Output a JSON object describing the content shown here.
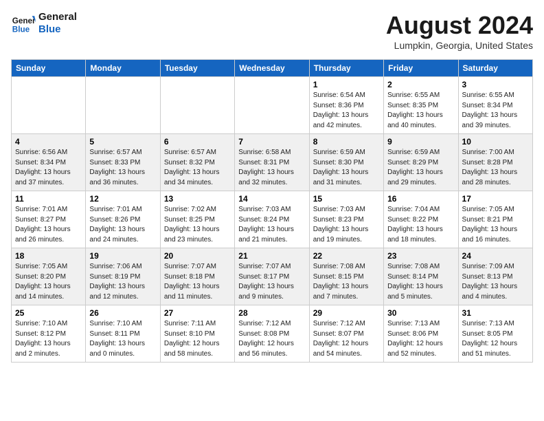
{
  "header": {
    "logo_general": "General",
    "logo_blue": "Blue",
    "month_title": "August 2024",
    "location": "Lumpkin, Georgia, United States"
  },
  "weekdays": [
    "Sunday",
    "Monday",
    "Tuesday",
    "Wednesday",
    "Thursday",
    "Friday",
    "Saturday"
  ],
  "weeks": [
    [
      {
        "day": "",
        "info": ""
      },
      {
        "day": "",
        "info": ""
      },
      {
        "day": "",
        "info": ""
      },
      {
        "day": "",
        "info": ""
      },
      {
        "day": "1",
        "info": "Sunrise: 6:54 AM\nSunset: 8:36 PM\nDaylight: 13 hours\nand 42 minutes."
      },
      {
        "day": "2",
        "info": "Sunrise: 6:55 AM\nSunset: 8:35 PM\nDaylight: 13 hours\nand 40 minutes."
      },
      {
        "day": "3",
        "info": "Sunrise: 6:55 AM\nSunset: 8:34 PM\nDaylight: 13 hours\nand 39 minutes."
      }
    ],
    [
      {
        "day": "4",
        "info": "Sunrise: 6:56 AM\nSunset: 8:34 PM\nDaylight: 13 hours\nand 37 minutes."
      },
      {
        "day": "5",
        "info": "Sunrise: 6:57 AM\nSunset: 8:33 PM\nDaylight: 13 hours\nand 36 minutes."
      },
      {
        "day": "6",
        "info": "Sunrise: 6:57 AM\nSunset: 8:32 PM\nDaylight: 13 hours\nand 34 minutes."
      },
      {
        "day": "7",
        "info": "Sunrise: 6:58 AM\nSunset: 8:31 PM\nDaylight: 13 hours\nand 32 minutes."
      },
      {
        "day": "8",
        "info": "Sunrise: 6:59 AM\nSunset: 8:30 PM\nDaylight: 13 hours\nand 31 minutes."
      },
      {
        "day": "9",
        "info": "Sunrise: 6:59 AM\nSunset: 8:29 PM\nDaylight: 13 hours\nand 29 minutes."
      },
      {
        "day": "10",
        "info": "Sunrise: 7:00 AM\nSunset: 8:28 PM\nDaylight: 13 hours\nand 28 minutes."
      }
    ],
    [
      {
        "day": "11",
        "info": "Sunrise: 7:01 AM\nSunset: 8:27 PM\nDaylight: 13 hours\nand 26 minutes."
      },
      {
        "day": "12",
        "info": "Sunrise: 7:01 AM\nSunset: 8:26 PM\nDaylight: 13 hours\nand 24 minutes."
      },
      {
        "day": "13",
        "info": "Sunrise: 7:02 AM\nSunset: 8:25 PM\nDaylight: 13 hours\nand 23 minutes."
      },
      {
        "day": "14",
        "info": "Sunrise: 7:03 AM\nSunset: 8:24 PM\nDaylight: 13 hours\nand 21 minutes."
      },
      {
        "day": "15",
        "info": "Sunrise: 7:03 AM\nSunset: 8:23 PM\nDaylight: 13 hours\nand 19 minutes."
      },
      {
        "day": "16",
        "info": "Sunrise: 7:04 AM\nSunset: 8:22 PM\nDaylight: 13 hours\nand 18 minutes."
      },
      {
        "day": "17",
        "info": "Sunrise: 7:05 AM\nSunset: 8:21 PM\nDaylight: 13 hours\nand 16 minutes."
      }
    ],
    [
      {
        "day": "18",
        "info": "Sunrise: 7:05 AM\nSunset: 8:20 PM\nDaylight: 13 hours\nand 14 minutes."
      },
      {
        "day": "19",
        "info": "Sunrise: 7:06 AM\nSunset: 8:19 PM\nDaylight: 13 hours\nand 12 minutes."
      },
      {
        "day": "20",
        "info": "Sunrise: 7:07 AM\nSunset: 8:18 PM\nDaylight: 13 hours\nand 11 minutes."
      },
      {
        "day": "21",
        "info": "Sunrise: 7:07 AM\nSunset: 8:17 PM\nDaylight: 13 hours\nand 9 minutes."
      },
      {
        "day": "22",
        "info": "Sunrise: 7:08 AM\nSunset: 8:15 PM\nDaylight: 13 hours\nand 7 minutes."
      },
      {
        "day": "23",
        "info": "Sunrise: 7:08 AM\nSunset: 8:14 PM\nDaylight: 13 hours\nand 5 minutes."
      },
      {
        "day": "24",
        "info": "Sunrise: 7:09 AM\nSunset: 8:13 PM\nDaylight: 13 hours\nand 4 minutes."
      }
    ],
    [
      {
        "day": "25",
        "info": "Sunrise: 7:10 AM\nSunset: 8:12 PM\nDaylight: 13 hours\nand 2 minutes."
      },
      {
        "day": "26",
        "info": "Sunrise: 7:10 AM\nSunset: 8:11 PM\nDaylight: 13 hours\nand 0 minutes."
      },
      {
        "day": "27",
        "info": "Sunrise: 7:11 AM\nSunset: 8:10 PM\nDaylight: 12 hours\nand 58 minutes."
      },
      {
        "day": "28",
        "info": "Sunrise: 7:12 AM\nSunset: 8:08 PM\nDaylight: 12 hours\nand 56 minutes."
      },
      {
        "day": "29",
        "info": "Sunrise: 7:12 AM\nSunset: 8:07 PM\nDaylight: 12 hours\nand 54 minutes."
      },
      {
        "day": "30",
        "info": "Sunrise: 7:13 AM\nSunset: 8:06 PM\nDaylight: 12 hours\nand 52 minutes."
      },
      {
        "day": "31",
        "info": "Sunrise: 7:13 AM\nSunset: 8:05 PM\nDaylight: 12 hours\nand 51 minutes."
      }
    ]
  ]
}
